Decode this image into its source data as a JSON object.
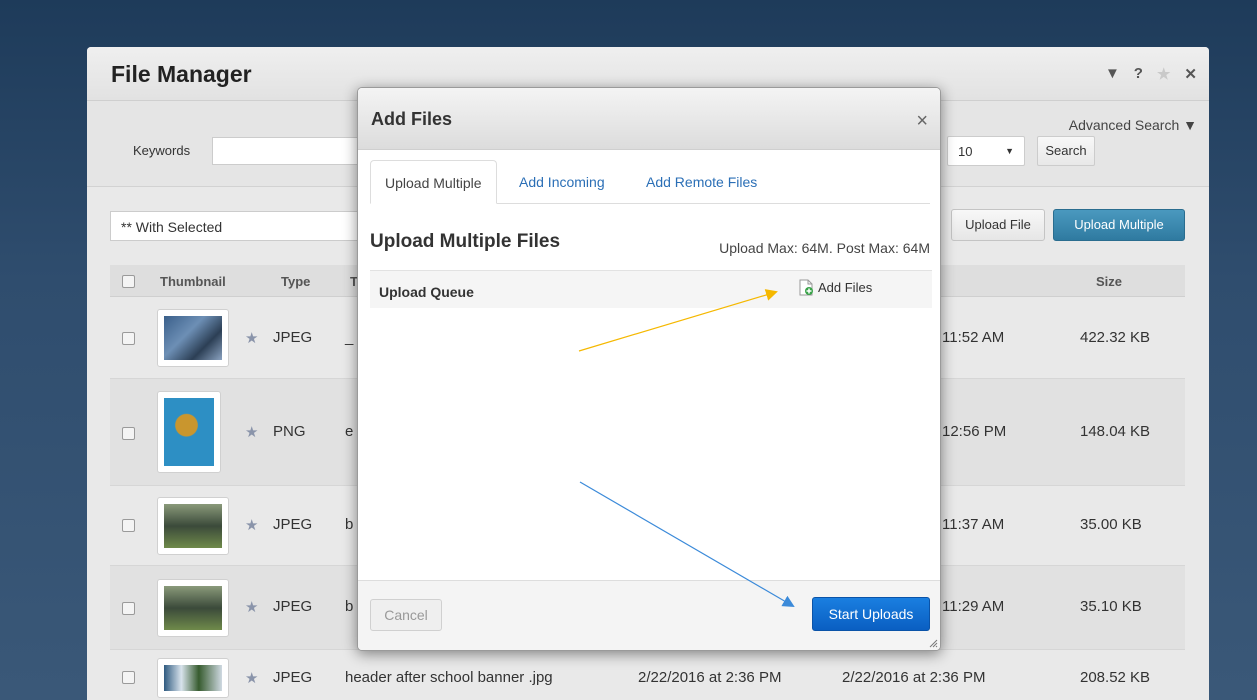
{
  "file_manager": {
    "title": "File Manager",
    "controls": [
      "▼",
      "?",
      "★",
      "✕"
    ],
    "keywords_label": "Keywords",
    "advanced_search": "Advanced Search ▼",
    "per_page": "10",
    "search_button": "Search",
    "with_selected": "** With Selected",
    "upload_file_button": "Upload File",
    "upload_multiple_button": "Upload Multiple",
    "columns": {
      "thumbnail": "Thumbnail",
      "type": "Type",
      "title_initial": "T",
      "size": "Size"
    },
    "rows": [
      {
        "type": "JPEG",
        "title": "_",
        "time": "11:52 AM",
        "size": "422.32 KB"
      },
      {
        "type": "PNG",
        "title": "e",
        "time": "12:56 PM",
        "size": "148.04 KB"
      },
      {
        "type": "JPEG",
        "title": "b",
        "time": "11:37 AM",
        "size": "35.00 KB"
      },
      {
        "type": "JPEG",
        "title": "b",
        "time": "11:29 AM",
        "size": "35.10 KB"
      },
      {
        "type": "JPEG",
        "title": "header after school banner .jpg",
        "created": "2/22/2016 at 2:36 PM",
        "time": "2/22/2016 at 2:36 PM",
        "size": "208.52 KB"
      }
    ]
  },
  "modal": {
    "title": "Add Files",
    "close": "×",
    "tabs": [
      {
        "label": "Upload Multiple",
        "active": true
      },
      {
        "label": "Add Incoming",
        "active": false
      },
      {
        "label": "Add Remote Files",
        "active": false
      }
    ],
    "upload_title": "Upload Multiple Files",
    "upload_max": "Upload Max: 64M. Post Max: 64M",
    "queue_label": "Upload Queue",
    "add_files": "Add Files",
    "cancel": "Cancel",
    "start_uploads": "Start Uploads"
  },
  "colors": {
    "accent_blue": "#0a6fd6",
    "upload_multiple_bg": "#3a8bb3",
    "arrow_yellow": "#f5b800",
    "arrow_blue": "#3b8ad9"
  }
}
